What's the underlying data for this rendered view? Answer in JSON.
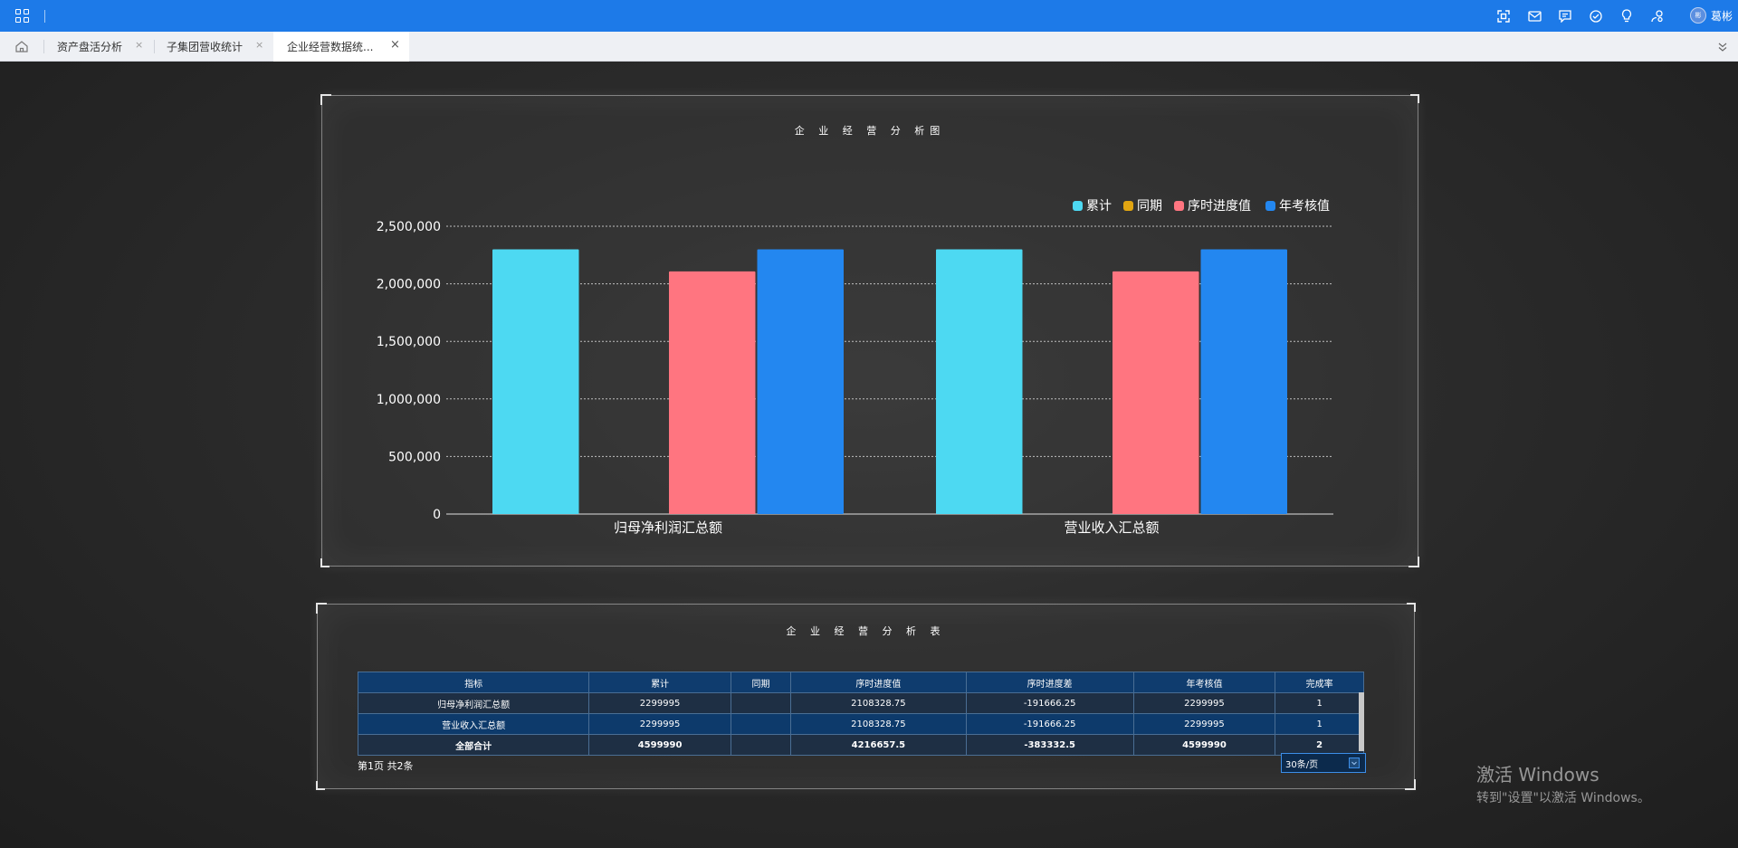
{
  "topbar": {
    "user_name": "葛彬",
    "avatar_text": "彬",
    "icons": [
      "fullscreen-icon",
      "mail-icon",
      "message-icon",
      "check-circle-icon",
      "bulb-icon",
      "user-settings-icon"
    ],
    "accent": "#1d7ae8"
  },
  "tabs": [
    {
      "label": "资产盘活分析",
      "close": "×"
    },
    {
      "label": "子集团营收统计",
      "close": "×"
    },
    {
      "label": "企业经营数据统...",
      "close": "×"
    }
  ],
  "chart_panel": {
    "title": "企 业 经 营 分 析图"
  },
  "chart_data": {
    "type": "bar",
    "title": "企 业 经 营 分 析图",
    "categories": [
      "归母净利润汇总额",
      "营业收入汇总额"
    ],
    "series": [
      {
        "name": "累计",
        "color": "#4dd9f2",
        "values": [
          2299995,
          2299995
        ]
      },
      {
        "name": "同期",
        "color": "#e1a511",
        "values": [
          null,
          null
        ]
      },
      {
        "name": "序时进度值",
        "color": "#ff7580",
        "values": [
          2108328.75,
          2108328.75
        ]
      },
      {
        "name": "年考核值",
        "color": "#2387f0",
        "values": [
          2299995,
          2299995
        ]
      }
    ],
    "yticks": [
      "0",
      "500,000",
      "1,000,000",
      "1,500,000",
      "2,000,000",
      "2,500,000"
    ],
    "ylim": [
      0,
      2500000
    ],
    "grid": true,
    "legend": "top-right"
  },
  "table_panel": {
    "title": "企 业 经 营 分 析 表",
    "columns": [
      "指标",
      "累计",
      "同期",
      "序时进度值",
      "序时进度差",
      "年考核值",
      "完成率"
    ],
    "rows": [
      [
        "归母净利润汇总额",
        "2299995",
        "",
        "2108328.75",
        "-191666.25",
        "2299995",
        "1"
      ],
      [
        "营业收入汇总额",
        "2299995",
        "",
        "2108328.75",
        "-191666.25",
        "2299995",
        "1"
      ],
      [
        "全部合计",
        "4599990",
        "",
        "4216657.5",
        "-383332.5",
        "4599990",
        "2"
      ]
    ],
    "pager_text": "第1页  共2条",
    "page_size": "30条/页"
  },
  "watermark": {
    "line1": "激活 Windows",
    "line2": "转到\"设置\"以激活 Windows。"
  }
}
